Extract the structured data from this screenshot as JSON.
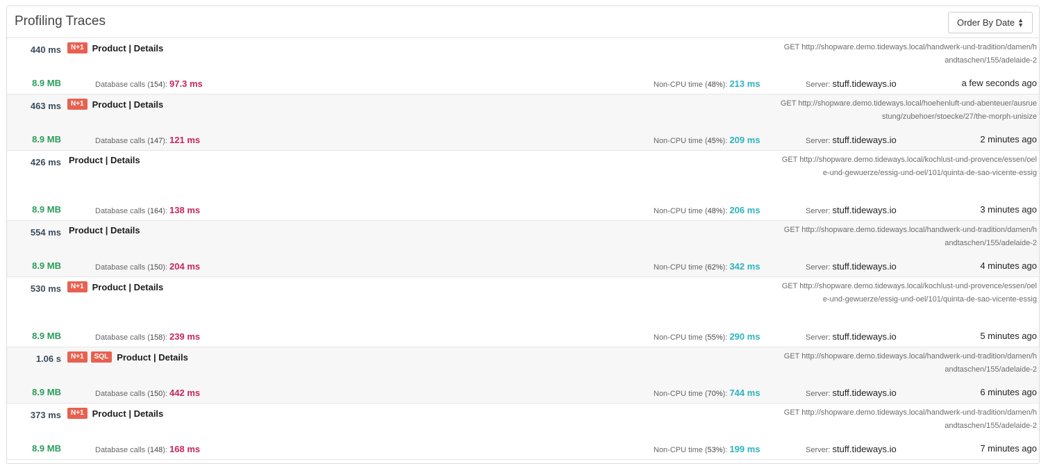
{
  "header": {
    "title": "Profiling Traces",
    "order_button_label": "Order By Date"
  },
  "labels": {
    "db_prefix": "Database calls",
    "noncpu_prefix": "Non-CPU time",
    "server_prefix": "Server:"
  },
  "traces": [
    {
      "duration": "440 ms",
      "badges": [
        "N+1"
      ],
      "name": "Product",
      "sep": "|",
      "action": "Details",
      "url": "GET http://shopware.demo.tideways.local/handwerk-und-tradition/damen/handtaschen/155/adelaide-2",
      "memory": "8.9 MB",
      "db_calls": "154",
      "db_time": "97.3 ms",
      "noncpu_pct": "48%",
      "noncpu_time": "213 ms",
      "server": "stuff.tideways.io",
      "ago": "a few seconds ago"
    },
    {
      "duration": "463 ms",
      "badges": [
        "N+1"
      ],
      "name": "Product",
      "sep": "|",
      "action": "Details",
      "url": "GET http://shopware.demo.tideways.local/hoehenluft-und-abenteuer/ausruestung/zubehoer/stoecke/27/the-morph-unisize",
      "memory": "8.9 MB",
      "db_calls": "147",
      "db_time": "121 ms",
      "noncpu_pct": "45%",
      "noncpu_time": "209 ms",
      "server": "stuff.tideways.io",
      "ago": "2 minutes ago"
    },
    {
      "duration": "426 ms",
      "badges": [],
      "name": "Product",
      "sep": "|",
      "action": "Details",
      "url": "GET http://shopware.demo.tideways.local/kochlust-und-provence/essen/oele-und-gewuerze/essig-und-oel/101/quinta-de-sao-vicente-essig",
      "memory": "8.9 MB",
      "db_calls": "164",
      "db_time": "138 ms",
      "noncpu_pct": "48%",
      "noncpu_time": "206 ms",
      "server": "stuff.tideways.io",
      "ago": "3 minutes ago"
    },
    {
      "duration": "554 ms",
      "badges": [],
      "name": "Product",
      "sep": "|",
      "action": "Details",
      "url": "GET http://shopware.demo.tideways.local/handwerk-und-tradition/damen/handtaschen/155/adelaide-2",
      "memory": "8.9 MB",
      "db_calls": "150",
      "db_time": "204 ms",
      "noncpu_pct": "62%",
      "noncpu_time": "342 ms",
      "server": "stuff.tideways.io",
      "ago": "4 minutes ago"
    },
    {
      "duration": "530 ms",
      "badges": [
        "N+1"
      ],
      "name": "Product",
      "sep": "|",
      "action": "Details",
      "url": "GET http://shopware.demo.tideways.local/kochlust-und-provence/essen/oele-und-gewuerze/essig-und-oel/101/quinta-de-sao-vicente-essig",
      "memory": "8.9 MB",
      "db_calls": "158",
      "db_time": "239 ms",
      "noncpu_pct": "55%",
      "noncpu_time": "290 ms",
      "server": "stuff.tideways.io",
      "ago": "5 minutes ago"
    },
    {
      "duration": "1.06 s",
      "badges": [
        "N+1",
        "SQL"
      ],
      "name": "Product",
      "sep": "|",
      "action": "Details",
      "url": "GET http://shopware.demo.tideways.local/handwerk-und-tradition/damen/handtaschen/155/adelaide-2",
      "memory": "8.9 MB",
      "db_calls": "150",
      "db_time": "442 ms",
      "noncpu_pct": "70%",
      "noncpu_time": "744 ms",
      "server": "stuff.tideways.io",
      "ago": "6 minutes ago"
    },
    {
      "duration": "373 ms",
      "badges": [
        "N+1"
      ],
      "name": "Product",
      "sep": "|",
      "action": "Details",
      "url": "GET http://shopware.demo.tideways.local/handwerk-und-tradition/damen/handtaschen/155/adelaide-2",
      "memory": "8.9 MB",
      "db_calls": "148",
      "db_time": "168 ms",
      "noncpu_pct": "53%",
      "noncpu_time": "199 ms",
      "server": "stuff.tideways.io",
      "ago": "7 minutes ago"
    }
  ]
}
